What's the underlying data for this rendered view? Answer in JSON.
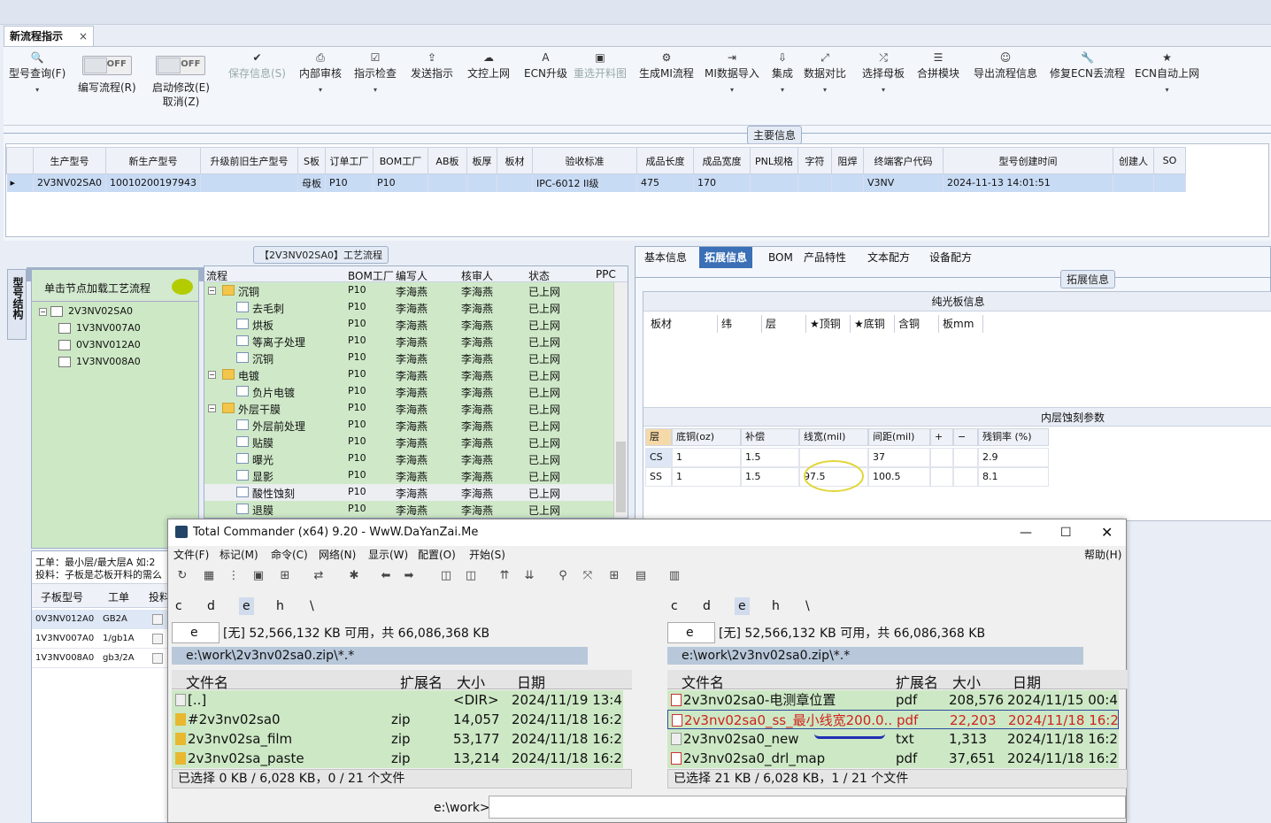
{
  "doc_tab": {
    "title": "新流程指示",
    "close": "×"
  },
  "ribbon": {
    "buttons": [
      {
        "icon": "search-icon",
        "glyph": "🔍",
        "label": "型号查询(F)",
        "dd": "▾"
      },
      {
        "icon": "toggle",
        "label": "编写流程(R)",
        "toggle_text": "OFF"
      },
      {
        "icon": "toggle",
        "label": "启动修改(E)",
        "label2": "取消(Z)",
        "toggle_text": "OFF"
      },
      {
        "icon": "check-icon",
        "glyph": "✔",
        "label": "保存信息(S)"
      },
      {
        "icon": "print-icon",
        "glyph": "⎙",
        "label": "内部审核",
        "dd": "▾"
      },
      {
        "icon": "checkbox-icon",
        "glyph": "☑",
        "label": "指示检查",
        "dd": "▾"
      },
      {
        "icon": "upload-icon",
        "glyph": "⇪",
        "label": "发送指示"
      },
      {
        "icon": "cloud-upload-icon",
        "glyph": "☁",
        "label": "文控上网"
      },
      {
        "icon": "ecn-icon",
        "glyph": "A",
        "label": "ECN升级"
      },
      {
        "icon": "image-icon",
        "glyph": "▣",
        "label": "重选开料图"
      },
      {
        "icon": "gears-icon",
        "glyph": "⚙",
        "label": "生成MI流程"
      },
      {
        "icon": "import-icon",
        "glyph": "⇥",
        "label": "MI数据导入",
        "dd": "▾"
      },
      {
        "icon": "download-icon",
        "glyph": "⇩",
        "label": "集成",
        "dd": "▾"
      },
      {
        "icon": "compare-icon",
        "glyph": "⤢",
        "label": "数据对比",
        "dd": "▾"
      },
      {
        "icon": "shuffle-icon",
        "glyph": "⤮",
        "label": "选择母板",
        "dd": "▾"
      },
      {
        "icon": "list-icon",
        "glyph": "☰",
        "label": "合拼模块"
      },
      {
        "icon": "smile-icon",
        "glyph": "☺",
        "label": "导出流程信息"
      },
      {
        "icon": "wrench-icon",
        "glyph": "🔧",
        "label": "修复ECN丢流程"
      },
      {
        "icon": "star-icon",
        "glyph": "★",
        "label": "ECN自动上网",
        "dd": "▾"
      }
    ]
  },
  "main_info": {
    "label": "主要信息",
    "columns": [
      "生产型号",
      "新生产型号",
      "升级前旧生产型号",
      "S板",
      "订单工厂",
      "BOM工厂",
      "AB板",
      "板厚",
      "板材",
      "验收标准",
      "成品长度",
      "成品宽度",
      "PNL规格",
      "字符",
      "阻焊",
      "终端客户代码",
      "型号创建时间",
      "创建人",
      "SO"
    ],
    "row": [
      "2V3NV02SA0",
      "10010200197943",
      "",
      "母板",
      "P10",
      "P10",
      "",
      "",
      "",
      "IPC-6012 II级",
      "475",
      "170",
      "",
      "",
      "",
      "V3NV",
      "2024-11-13 14:01:51",
      "",
      ""
    ],
    "row_marker": "▸"
  },
  "process": {
    "label": "【2V3NV02SA0】工艺流程",
    "side_tab": "型号结构",
    "tree_header": "单击节点加载工艺流程",
    "tree_nodes": [
      "2V3NV02SA0",
      "1V3NV007A0",
      "0V3NV012A0",
      "1V3NV008A0"
    ],
    "flow_cols": [
      "流程",
      "BOM工厂",
      "编写人",
      "核审人",
      "状态",
      "PPC"
    ],
    "flow_rows": [
      {
        "name": "沉铜",
        "folder": true,
        "level": 0,
        "bom": "P10",
        "w": "李海燕",
        "c": "李海燕",
        "s": "已上网"
      },
      {
        "name": "去毛刺",
        "folder": false,
        "level": 1,
        "bom": "P10",
        "w": "李海燕",
        "c": "李海燕",
        "s": "已上网"
      },
      {
        "name": "烘板",
        "folder": false,
        "level": 1,
        "bom": "P10",
        "w": "李海燕",
        "c": "李海燕",
        "s": "已上网"
      },
      {
        "name": "等离子处理",
        "folder": false,
        "level": 1,
        "bom": "P10",
        "w": "李海燕",
        "c": "李海燕",
        "s": "已上网"
      },
      {
        "name": "沉铜",
        "folder": false,
        "level": 1,
        "bom": "P10",
        "w": "李海燕",
        "c": "李海燕",
        "s": "已上网"
      },
      {
        "name": "电镀",
        "folder": true,
        "level": 0,
        "bom": "P10",
        "w": "李海燕",
        "c": "李海燕",
        "s": "已上网"
      },
      {
        "name": "负片电镀",
        "folder": false,
        "level": 1,
        "bom": "P10",
        "w": "李海燕",
        "c": "李海燕",
        "s": "已上网"
      },
      {
        "name": "外层干膜",
        "folder": true,
        "level": 0,
        "bom": "P10",
        "w": "李海燕",
        "c": "李海燕",
        "s": "已上网"
      },
      {
        "name": "外层前处理",
        "folder": false,
        "level": 1,
        "bom": "P10",
        "w": "李海燕",
        "c": "李海燕",
        "s": "已上网"
      },
      {
        "name": "贴膜",
        "folder": false,
        "level": 1,
        "bom": "P10",
        "w": "李海燕",
        "c": "李海燕",
        "s": "已上网"
      },
      {
        "name": "曝光",
        "folder": false,
        "level": 1,
        "bom": "P10",
        "w": "李海燕",
        "c": "李海燕",
        "s": "已上网"
      },
      {
        "name": "显影",
        "folder": false,
        "level": 1,
        "bom": "P10",
        "w": "李海燕",
        "c": "李海燕",
        "s": "已上网"
      },
      {
        "name": "酸性蚀刻",
        "folder": false,
        "level": 1,
        "bom": "P10",
        "w": "李海燕",
        "c": "李海燕",
        "s": "已上网"
      },
      {
        "name": "退膜",
        "folder": false,
        "level": 1,
        "bom": "P10",
        "w": "李海燕",
        "c": "李海燕",
        "s": "已上网"
      }
    ],
    "note_line1": "工单：最小层/最大层A 如:2",
    "note_line2": "投料：子板是芯板开料的需么",
    "sub_cols": [
      "子板型号",
      "工单",
      "投料"
    ],
    "sub_rows": [
      [
        "0V3NV012A0",
        "GB2A"
      ],
      [
        "1V3NV007A0",
        "1/gb1A"
      ],
      [
        "1V3NV008A0",
        "gb3/2A"
      ]
    ]
  },
  "right": {
    "tabs": [
      "基本信息",
      "拓展信息",
      "BOM",
      "产品特性",
      "文本配方",
      "设备配方"
    ],
    "active_tab": 1,
    "label": "拓展信息",
    "guangban": {
      "title": "纯光板信息",
      "cols": [
        "板材",
        "纬",
        "层",
        "★顶铜",
        "★底铜",
        "含铜",
        "板mm"
      ]
    },
    "etch": {
      "title": "内层蚀刻参数",
      "cols": [
        "层",
        "底铜(oz)",
        "补偿",
        "线宽(mil)",
        "间距(mil)",
        "+",
        "−",
        "残铜率 (%)"
      ],
      "rows": [
        [
          "CS",
          "1",
          "1.5",
          "",
          "37",
          "",
          "",
          "2.9"
        ],
        [
          "SS",
          "1",
          "1.5",
          "97.5",
          "100.5",
          "",
          "",
          "8.1"
        ]
      ]
    }
  },
  "tc": {
    "title": "Total Commander (x64) 9.20 - WwW.DaYanZai.Me",
    "menu": [
      "文件(F)",
      "标记(M)",
      "命令(C)",
      "网络(N)",
      "显示(W)",
      "配置(O)",
      "开始(S)"
    ],
    "help": "帮助(H)",
    "drives": [
      "c",
      "d",
      "e",
      "h",
      "\\"
    ],
    "drive_sel": "e",
    "free": "[无]  52,566,132 KB 可用，共 66,086,368 KB",
    "path": "e:\\work\\2v3nv02sa0.zip\\*.*",
    "cols": [
      "文件名",
      "扩展名",
      "大小",
      "日期"
    ],
    "left_files": [
      {
        "n": "[..]",
        "e": "",
        "s": "<DIR>",
        "d": "2024/11/19 13:4"
      },
      {
        "n": "#2v3nv02sa0",
        "e": "zip",
        "s": "14,057",
        "d": "2024/11/18 16:2"
      },
      {
        "n": "2v3nv02sa_film",
        "e": "zip",
        "s": "53,177",
        "d": "2024/11/18 16:2"
      },
      {
        "n": "2v3nv02sa_paste",
        "e": "zip",
        "s": "13,214",
        "d": "2024/11/18 16:2"
      }
    ],
    "right_files": [
      {
        "n": "2v3nv02sa0-电测章位置",
        "e": "pdf",
        "s": "208,576",
        "d": "2024/11/15 00:4"
      },
      {
        "n": "2v3nv02sa0_ss_最小线宽200.0..",
        "e": "pdf",
        "s": "22,203",
        "d": "2024/11/18 16:2"
      },
      {
        "n": "2v3nv02sa0_new",
        "e": "txt",
        "s": "1,313",
        "d": "2024/11/18 16:2"
      },
      {
        "n": "2v3nv02sa0_drl_map",
        "e": "pdf",
        "s": "37,651",
        "d": "2024/11/18 16:2"
      }
    ],
    "left_status": "已选择 0 KB / 6,028 KB，0 / 21 个文件",
    "right_status": "已选择 21 KB / 6,028 KB，1 / 21 个文件",
    "cmd_label": "e:\\work>"
  }
}
